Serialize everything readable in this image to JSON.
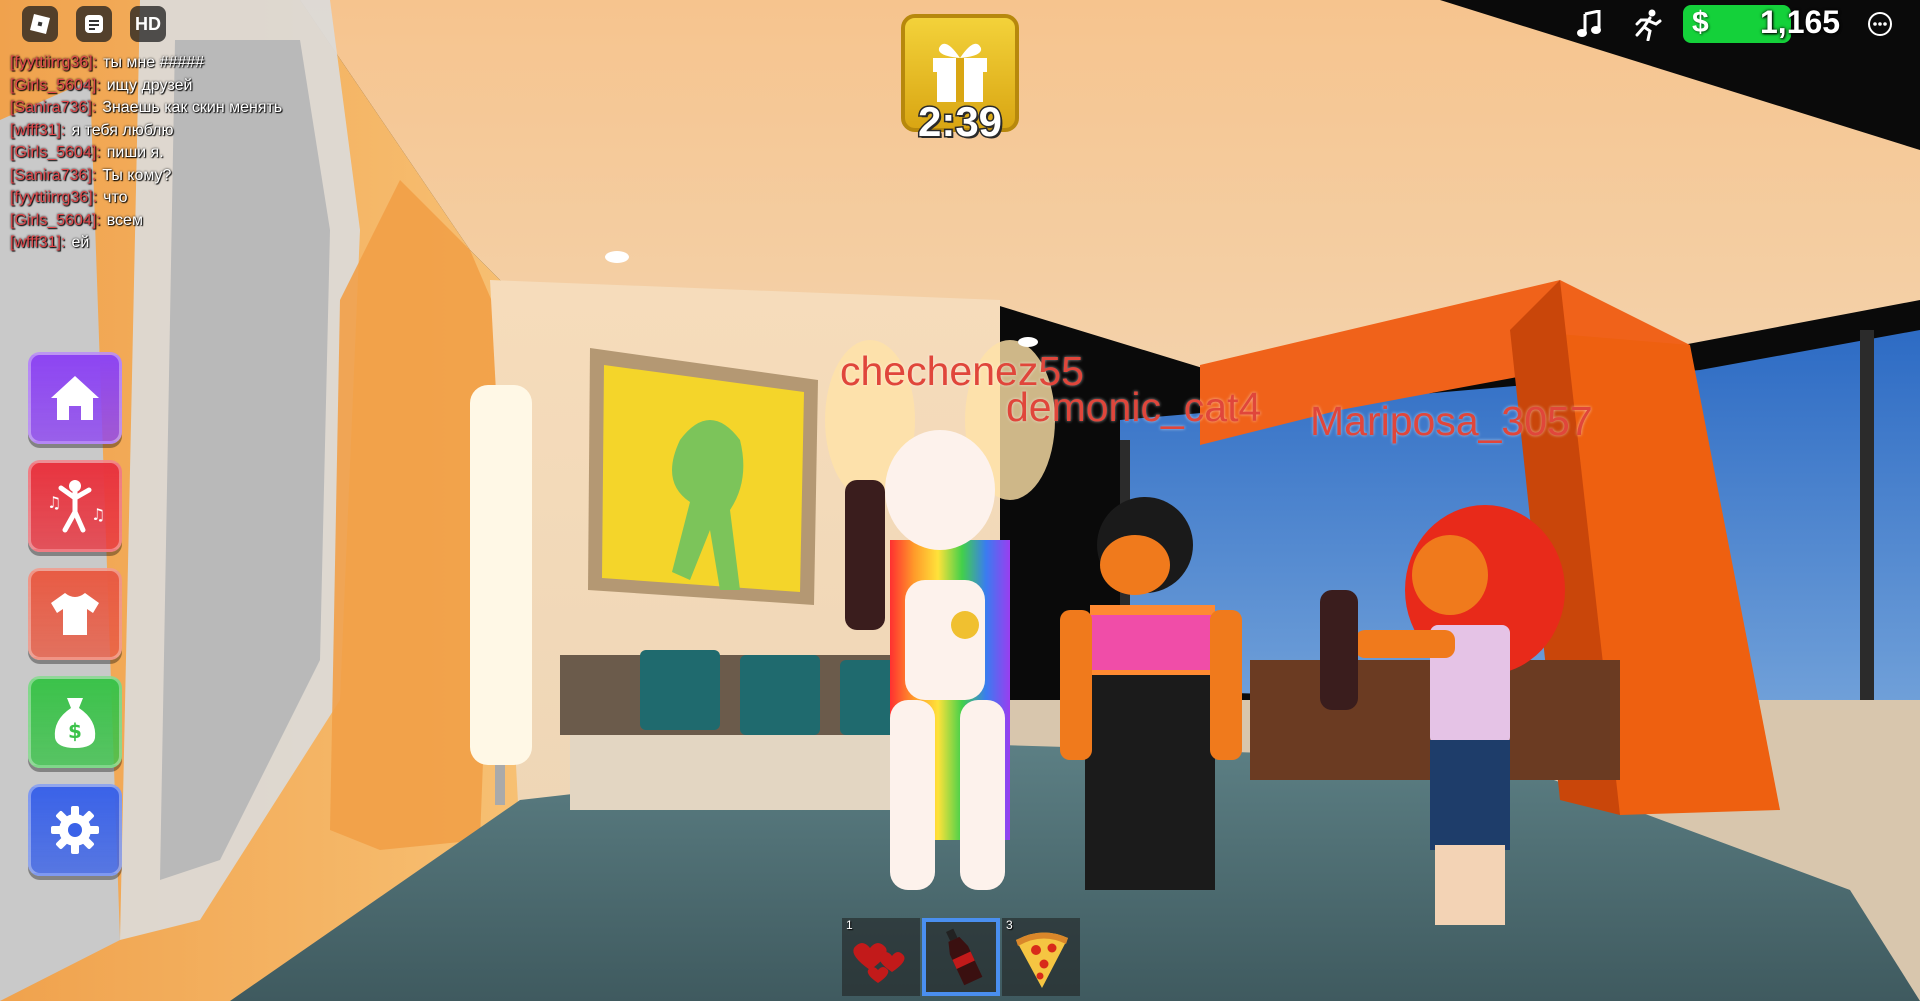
{
  "topbar": {
    "menu_icon": "roblox-logo-icon",
    "chat_icon": "chat-icon",
    "hd_label": "HD",
    "music_icon": "music-note-icon",
    "sprint_icon": "running-figure-icon",
    "money_sign": "$",
    "money_value": "1,165",
    "more_icon": "more-options-icon"
  },
  "chat": [
    {
      "name": "[fyyttiirrg36]:",
      "message": "ты мне #####"
    },
    {
      "name": "[Girls_5604]:",
      "message": "ищу друзей"
    },
    {
      "name": "[Sanira736]:",
      "message": "Знаешь как скин менять"
    },
    {
      "name": "[wfff31]:",
      "message": "я тебя люблю"
    },
    {
      "name": "[Girls_5604]:",
      "message": "пиши я."
    },
    {
      "name": "[Sanira736]:",
      "message": "Ты кому?"
    },
    {
      "name": "[fyyttiirrg36]:",
      "message": "что"
    },
    {
      "name": "[Girls_5604]:",
      "message": "всем"
    },
    {
      "name": "[wfff31]:",
      "message": "ей"
    }
  ],
  "side_menu": [
    {
      "icon": "home-icon",
      "color": "#8d45f2"
    },
    {
      "icon": "dance-icon",
      "color": "#e8343f"
    },
    {
      "icon": "shirt-icon",
      "color": "#e85b44"
    },
    {
      "icon": "money-bag-icon",
      "color": "#3bc24a"
    },
    {
      "icon": "gear-icon",
      "color": "#3a62e8"
    }
  ],
  "gift": {
    "icon": "gift-icon",
    "timer": "2:39"
  },
  "players": [
    "chechenez55",
    "demonic_cat4",
    "Mariposa_3057"
  ],
  "hotbar": [
    {
      "number": "1",
      "icon": "hearts-icon",
      "selected": false
    },
    {
      "number": "",
      "icon": "cola-bottle-icon",
      "selected": true
    },
    {
      "number": "3",
      "icon": "pizza-slice-icon",
      "selected": false
    }
  ],
  "colors": {
    "player_name": "#e0463b",
    "chat_name": "#e0484c",
    "money_bg": "#14d13a",
    "hotbar_selected": "#4a8ff0"
  }
}
